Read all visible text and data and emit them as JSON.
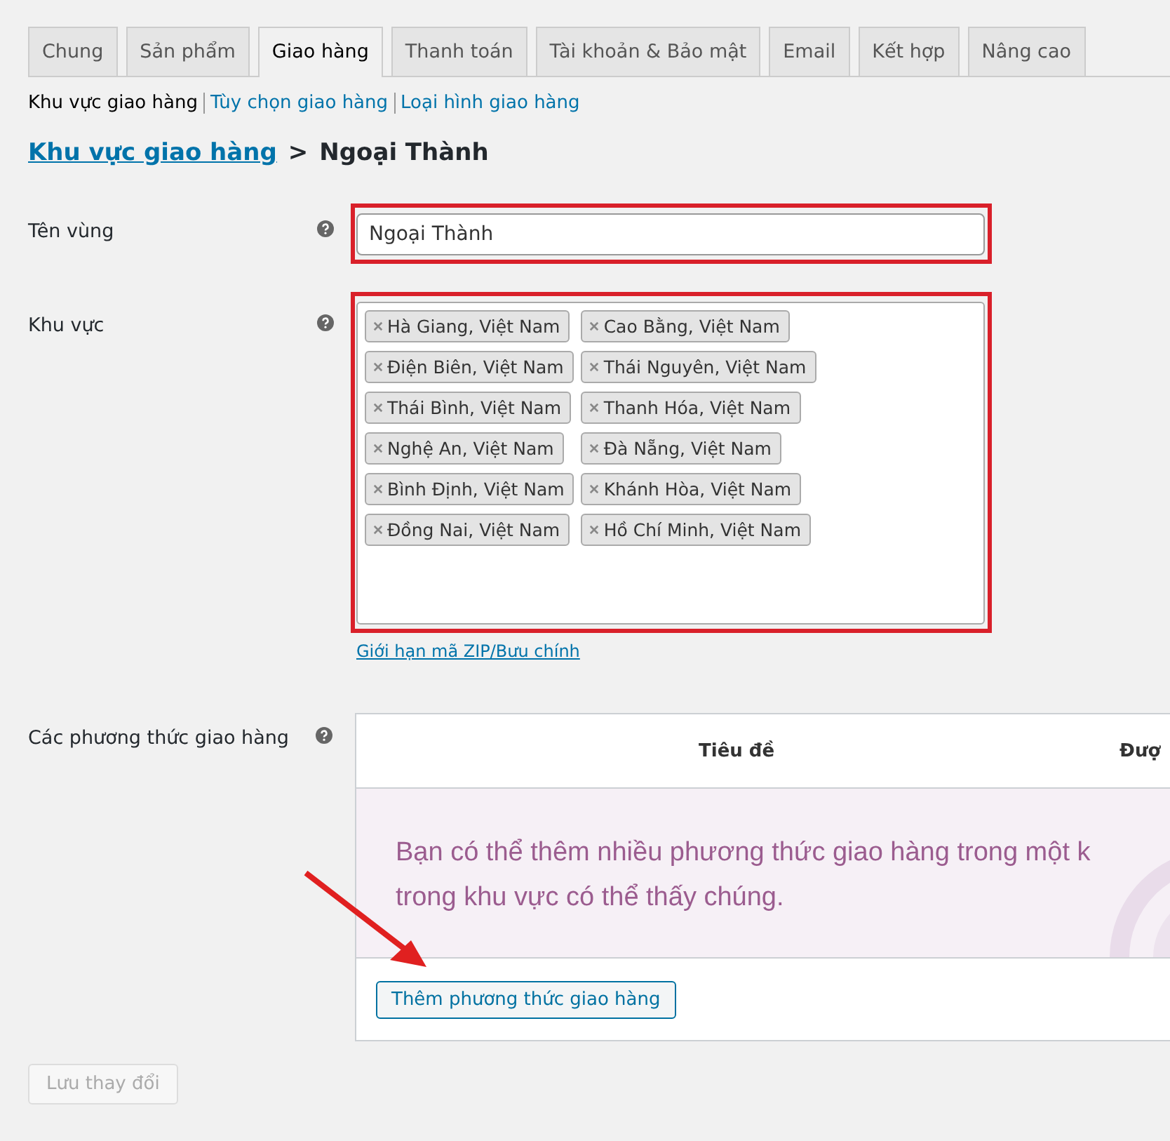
{
  "tabs": [
    {
      "label": "Chung",
      "selected": false
    },
    {
      "label": "Sản phẩm",
      "selected": false
    },
    {
      "label": "Giao hàng",
      "selected": true
    },
    {
      "label": "Thanh toán",
      "selected": false
    },
    {
      "label": "Tài khoản & Bảo mật",
      "selected": false
    },
    {
      "label": "Email",
      "selected": false
    },
    {
      "label": "Kết hợp",
      "selected": false
    },
    {
      "label": "Nâng cao",
      "selected": false
    }
  ],
  "subnav": [
    {
      "label": "Khu vực giao hàng",
      "selected": true
    },
    {
      "label": "Tùy chọn giao hàng",
      "selected": false
    },
    {
      "label": "Loại hình giao hàng",
      "selected": false
    }
  ],
  "breadcrumb": {
    "link": "Khu vực giao hàng",
    "separator": ">",
    "current": "Ngoại Thành"
  },
  "zone_name": {
    "label": "Tên vùng",
    "value": "Ngoại Thành"
  },
  "regions": {
    "label": "Khu vực",
    "tags": [
      "Hà Giang, Việt Nam",
      "Cao Bằng, Việt Nam",
      "Điện Biên, Việt Nam",
      "Thái Nguyên, Việt Nam",
      "Thái Bình, Việt Nam",
      "Thanh Hóa, Việt Nam",
      "Nghệ An, Việt Nam",
      "Đà Nẵng, Việt Nam",
      "Bình Định, Việt Nam",
      "Khánh Hòa, Việt Nam",
      "Đồng Nai, Việt Nam",
      "Hồ Chí Minh, Việt Nam"
    ],
    "link": "Giới hạn mã ZIP/Bưu chính"
  },
  "shipping_methods": {
    "label": "Các phương thức giao hàng",
    "columns": [
      "Tiêu đề",
      "Đượ"
    ],
    "message_lines": [
      "Bạn có thể thêm nhiều phương thức giao hàng trong một k",
      "trong khu vực có thể thấy chúng."
    ],
    "add_button": "Thêm phương thức giao hàng"
  },
  "save_button": {
    "label": "Lưu thay đổi",
    "disabled": true
  }
}
